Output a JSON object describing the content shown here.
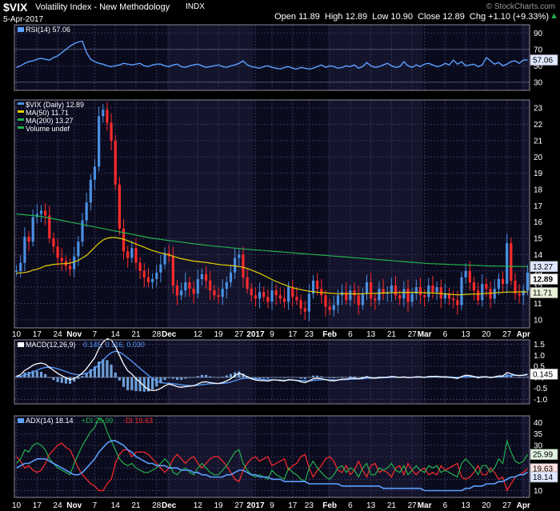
{
  "header": {
    "symbol": "$VIX",
    "title": "Volatility Index - New Methodology",
    "exchange": "INDX",
    "date": "5-Apr-2017",
    "watermark": "© StockCharts.com",
    "ohlc": "Open 11.89  High 12.89  Low 10.90  Close 12.89  Chg +1.10 (+9.33%)",
    "change_arrow": "▲"
  },
  "colors": {
    "background": "#000000",
    "panel": "#0b0b1e",
    "grid": "#35355a",
    "up": "#4a90e2",
    "down": "#ff2b2b",
    "ma50": "#e6d200",
    "ma200": "#22b14c",
    "rsi": "#5aa0ff",
    "macd_fast": "#ffffff",
    "macd_signal": "#5aa0ff",
    "macd_hist": "#6f9fd8",
    "adx": "#5aa0ff",
    "plus_di": "#22b14c",
    "minus_di": "#ff2b2b"
  },
  "x_axis": {
    "labels": [
      "10",
      "17",
      "24",
      "Nov",
      "7",
      "14",
      "21",
      "28",
      "Dec",
      "12",
      "19",
      "27",
      "2017",
      "9",
      "17",
      "23",
      "Feb",
      "6",
      "13",
      "21",
      "27",
      "Mar",
      "6",
      "13",
      "20",
      "27",
      "Apr"
    ],
    "label_index": [
      0,
      5,
      10,
      14,
      19,
      24,
      29,
      34,
      37,
      44,
      49,
      54,
      58,
      62,
      67,
      71,
      76,
      81,
      86,
      91,
      96,
      99,
      104,
      109,
      114,
      119,
      123
    ],
    "month_index": [
      14,
      37,
      58,
      76,
      99,
      123
    ]
  },
  "chart_data": [
    {
      "type": "line",
      "name": "rsi",
      "legend": "RSI(14) 57.06",
      "last_label": "57.06",
      "yticks": [
        "90",
        "70",
        "50",
        "30"
      ],
      "ylim": [
        20,
        100
      ],
      "ref_levels": [
        70,
        30
      ],
      "values": [
        48,
        50,
        53,
        55,
        56,
        58,
        59,
        58,
        57,
        60,
        62,
        66,
        70,
        74,
        77,
        79,
        80,
        66,
        58,
        55,
        53,
        52,
        50,
        49,
        50,
        51,
        53,
        52,
        51,
        52,
        53,
        50,
        49,
        51,
        52,
        52,
        50,
        49,
        51,
        52,
        49,
        48,
        50,
        51,
        52,
        50,
        48,
        49,
        50,
        51,
        49,
        48,
        50,
        51,
        53,
        56,
        51,
        49,
        48,
        47,
        49,
        50,
        48,
        47,
        46,
        48,
        49,
        47,
        46,
        48,
        47,
        46,
        47,
        49,
        51,
        48,
        50,
        49,
        47,
        48,
        50,
        49,
        51,
        47,
        49,
        54,
        50,
        48,
        49,
        51,
        53,
        50,
        48,
        49,
        55,
        50,
        48,
        51,
        49,
        52,
        53,
        51,
        49,
        50,
        53,
        51,
        57,
        52,
        55,
        50,
        51,
        52,
        49,
        51,
        60,
        56,
        52,
        54,
        50,
        52,
        55,
        56,
        53,
        57,
        57.06
      ]
    },
    {
      "type": "candlestick",
      "name": "price",
      "legend": [
        "$VIX (Daily) 12.89",
        "MA(50) 11.71",
        "MA(200) 13.27",
        "Volume undef"
      ],
      "yticks": [
        "23",
        "22",
        "21",
        "20",
        "19",
        "18",
        "17",
        "16",
        "15",
        "14",
        "13",
        "12",
        "11",
        "10"
      ],
      "ylim": [
        9.5,
        23.5
      ],
      "last_close_label": "12.89",
      "ma50_label": "11.71",
      "ma200_label": "13.27",
      "close": [
        13.0,
        13.5,
        15.1,
        14.8,
        16.3,
        16.5,
        16.7,
        16.4,
        15.0,
        14.5,
        13.8,
        13.6,
        13.3,
        13.1,
        13.9,
        14.8,
        16.1,
        17.2,
        18.6,
        19.4,
        22.5,
        22.9,
        22.1,
        21.0,
        18.3,
        15.6,
        14.2,
        13.8,
        14.4,
        13.5,
        13.0,
        12.6,
        12.3,
        12.5,
        12.9,
        13.4,
        14.1,
        13.9,
        12.1,
        11.5,
        11.8,
        12.3,
        11.9,
        11.6,
        12.5,
        12.8,
        12.4,
        11.8,
        11.5,
        11.4,
        11.9,
        12.3,
        12.9,
        13.8,
        14.0,
        12.6,
        11.9,
        11.5,
        11.3,
        11.7,
        11.4,
        11.1,
        11.8,
        11.5,
        11.3,
        11.1,
        12.0,
        11.4,
        11.2,
        10.7,
        10.5,
        11.6,
        12.4,
        11.9,
        11.5,
        10.8,
        10.6,
        10.9,
        11.5,
        11.7,
        11.2,
        11.8,
        11.5,
        10.9,
        11.6,
        12.3,
        11.3,
        11.2,
        11.9,
        11.6,
        11.7,
        12.1,
        11.5,
        11.3,
        11.9,
        11.1,
        11.6,
        12.0,
        11.5,
        11.4,
        12.1,
        11.7,
        12.0,
        11.3,
        11.6,
        11.3,
        11.2,
        10.9,
        12.6,
        13.0,
        12.3,
        11.8,
        11.2,
        12.2,
        11.9,
        11.3,
        11.9,
        12.5,
        12.2,
        14.7,
        12.4,
        11.6,
        11.5,
        11.8,
        12.89
      ],
      "ma50": [
        12.85,
        12.88,
        12.9,
        12.95,
        13.05,
        13.1,
        13.2,
        13.3,
        13.35,
        13.4,
        13.42,
        13.44,
        13.45,
        13.48,
        13.55,
        13.65,
        13.8,
        13.95,
        14.2,
        14.45,
        14.7,
        14.9,
        15.0,
        15.05,
        15.05,
        15.0,
        14.95,
        14.85,
        14.75,
        14.65,
        14.55,
        14.45,
        14.35,
        14.25,
        14.18,
        14.1,
        14.05,
        13.98,
        13.9,
        13.82,
        13.75,
        13.7,
        13.65,
        13.6,
        13.57,
        13.55,
        13.52,
        13.48,
        13.44,
        13.4,
        13.37,
        13.35,
        13.33,
        13.3,
        13.27,
        13.22,
        13.15,
        13.05,
        12.95,
        12.85,
        12.72,
        12.6,
        12.47,
        12.35,
        12.25,
        12.15,
        12.05,
        11.97,
        11.9,
        11.85,
        11.8,
        11.75,
        11.72,
        11.69,
        11.67,
        11.65,
        11.63,
        11.62,
        11.6,
        11.6,
        11.6,
        11.6,
        11.59,
        11.59,
        11.6,
        11.61,
        11.62,
        11.62,
        11.63,
        11.64,
        11.65,
        11.66,
        11.66,
        11.67,
        11.68,
        11.68,
        11.68,
        11.68,
        11.67,
        11.66,
        11.65,
        11.64,
        11.63,
        11.61,
        11.59,
        11.57,
        11.55,
        11.53,
        11.54,
        11.56,
        11.57,
        11.58,
        11.58,
        11.6,
        11.62,
        11.63,
        11.65,
        11.67,
        11.68,
        11.7,
        11.7,
        11.7,
        11.71,
        11.71,
        11.71
      ],
      "ma200": [
        16.5,
        16.47,
        16.45,
        16.42,
        16.4,
        16.37,
        16.35,
        16.3,
        16.25,
        16.2,
        16.15,
        16.1,
        16.05,
        16.0,
        15.95,
        15.9,
        15.85,
        15.8,
        15.75,
        15.7,
        15.65,
        15.6,
        15.55,
        15.5,
        15.45,
        15.4,
        15.35,
        15.3,
        15.25,
        15.2,
        15.15,
        15.1,
        15.05,
        15.0,
        14.97,
        14.94,
        14.9,
        14.87,
        14.84,
        14.8,
        14.77,
        14.74,
        14.7,
        14.67,
        14.64,
        14.61,
        14.58,
        14.55,
        14.52,
        14.5,
        14.47,
        14.45,
        14.42,
        14.4,
        14.38,
        14.35,
        14.33,
        14.31,
        14.29,
        14.27,
        14.25,
        14.23,
        14.21,
        14.19,
        14.17,
        14.15,
        14.13,
        14.11,
        14.09,
        14.07,
        14.05,
        14.03,
        14.01,
        13.99,
        13.97,
        13.95,
        13.93,
        13.91,
        13.89,
        13.87,
        13.85,
        13.83,
        13.81,
        13.79,
        13.77,
        13.75,
        13.73,
        13.71,
        13.69,
        13.67,
        13.65,
        13.63,
        13.61,
        13.59,
        13.57,
        13.55,
        13.53,
        13.51,
        13.49,
        13.47,
        13.45,
        13.44,
        13.43,
        13.42,
        13.41,
        13.4,
        13.39,
        13.38,
        13.37,
        13.36,
        13.35,
        13.34,
        13.33,
        13.32,
        13.31,
        13.3,
        13.3,
        13.29,
        13.29,
        13.28,
        13.28,
        13.28,
        13.27,
        13.27,
        13.27
      ]
    },
    {
      "type": "line",
      "name": "macd",
      "legend_main": "MACD(12,26,9)",
      "legend_values": "0.145, 0.116, 0.030",
      "last_label": "0.145",
      "yticks": [
        "1.5",
        "1.0",
        "0.5",
        "0.0",
        "-0.5",
        "-1.0"
      ],
      "ylim": [
        -1.2,
        1.7
      ],
      "zero_line": 0,
      "macd": [
        0.05,
        0.12,
        0.32,
        0.42,
        0.55,
        0.62,
        0.65,
        0.6,
        0.45,
        0.32,
        0.18,
        0.08,
        -0.02,
        -0.1,
        -0.05,
        0.05,
        0.2,
        0.4,
        0.65,
        0.9,
        1.3,
        1.6,
        1.75,
        1.7,
        1.4,
        1.0,
        0.6,
        0.3,
        0.15,
        -0.05,
        -0.22,
        -0.4,
        -0.55,
        -0.6,
        -0.58,
        -0.5,
        -0.38,
        -0.3,
        -0.35,
        -0.42,
        -0.45,
        -0.42,
        -0.4,
        -0.38,
        -0.3,
        -0.22,
        -0.2,
        -0.24,
        -0.26,
        -0.28,
        -0.24,
        -0.16,
        -0.06,
        0.08,
        0.18,
        0.12,
        0.02,
        -0.06,
        -0.12,
        -0.14,
        -0.15,
        -0.17,
        -0.12,
        -0.12,
        -0.14,
        -0.16,
        -0.1,
        -0.12,
        -0.14,
        -0.2,
        -0.24,
        -0.16,
        -0.06,
        -0.04,
        -0.06,
        -0.1,
        -0.14,
        -0.16,
        -0.12,
        -0.08,
        -0.08,
        -0.04,
        -0.04,
        -0.06,
        -0.03,
        0.02,
        -0.02,
        -0.04,
        0.0,
        0.0,
        0.01,
        0.04,
        0.02,
        0.0,
        0.02,
        -0.01,
        0.0,
        0.03,
        0.02,
        0.0,
        0.04,
        0.04,
        0.05,
        0.02,
        0.02,
        0.0,
        -0.02,
        -0.05,
        0.04,
        0.1,
        0.08,
        0.04,
        -0.02,
        0.02,
        0.03,
        -0.01,
        0.02,
        0.06,
        0.06,
        0.22,
        0.16,
        0.1,
        0.08,
        0.1,
        0.145
      ],
      "signal": [
        0.02,
        0.05,
        0.1,
        0.17,
        0.25,
        0.33,
        0.4,
        0.45,
        0.46,
        0.44,
        0.39,
        0.33,
        0.26,
        0.19,
        0.14,
        0.12,
        0.14,
        0.19,
        0.28,
        0.4,
        0.58,
        0.78,
        0.97,
        1.12,
        1.18,
        1.14,
        1.03,
        0.88,
        0.73,
        0.57,
        0.41,
        0.25,
        0.09,
        -0.05,
        -0.16,
        -0.23,
        -0.26,
        -0.27,
        -0.29,
        -0.31,
        -0.34,
        -0.36,
        -0.37,
        -0.37,
        -0.36,
        -0.33,
        -0.31,
        -0.29,
        -0.28,
        -0.28,
        -0.27,
        -0.25,
        -0.21,
        -0.15,
        -0.09,
        -0.05,
        -0.04,
        -0.04,
        -0.06,
        -0.08,
        -0.1,
        -0.11,
        -0.11,
        -0.12,
        -0.12,
        -0.13,
        -0.12,
        -0.12,
        -0.13,
        -0.14,
        -0.16,
        -0.16,
        -0.14,
        -0.12,
        -0.11,
        -0.11,
        -0.11,
        -0.12,
        -0.12,
        -0.11,
        -0.1,
        -0.09,
        -0.08,
        -0.07,
        -0.06,
        -0.04,
        -0.04,
        -0.04,
        -0.03,
        -0.02,
        -0.01,
        0.0,
        0.0,
        0.0,
        0.0,
        0.0,
        0.0,
        0.0,
        0.01,
        0.01,
        0.01,
        0.02,
        0.03,
        0.03,
        0.03,
        0.02,
        0.01,
        0.0,
        0.0,
        0.02,
        0.03,
        0.03,
        0.02,
        0.02,
        0.02,
        0.01,
        0.01,
        0.02,
        0.03,
        0.07,
        0.09,
        0.09,
        0.09,
        0.09,
        0.116
      ]
    },
    {
      "type": "line",
      "name": "adx",
      "legend_adx": "ADX(14) 18.14",
      "legend_pdi": "+DI 25.99",
      "legend_mdi": "-DI 19.63",
      "labels_right": [
        "25.99",
        "19.63",
        "18.14"
      ],
      "yticks": [
        "40",
        "35",
        "30",
        "25",
        "20",
        "15",
        "10"
      ],
      "ylim": [
        7,
        43
      ],
      "adx": [
        20,
        21,
        22,
        22,
        23,
        24,
        24,
        24,
        23,
        22,
        21,
        20,
        19,
        18,
        17,
        17,
        18,
        20,
        22,
        24,
        27,
        29,
        31,
        32,
        32,
        31,
        30,
        28,
        27,
        25,
        24,
        23,
        22,
        22,
        21,
        21,
        21,
        20,
        20,
        20,
        19,
        19,
        19,
        18,
        18,
        17,
        17,
        16,
        16,
        16,
        16,
        17,
        17,
        18,
        19,
        19,
        18,
        17,
        17,
        16,
        16,
        16,
        15,
        15,
        15,
        14,
        14,
        14,
        14,
        14,
        14,
        13,
        13,
        13,
        13,
        13,
        13,
        13,
        13,
        12,
        12,
        12,
        12,
        12,
        12,
        12,
        12,
        12,
        12,
        11,
        11,
        11,
        11,
        11,
        11,
        11,
        11,
        11,
        11,
        10,
        10,
        10,
        10,
        10,
        10,
        10,
        10,
        10,
        10,
        11,
        11,
        12,
        12,
        12,
        13,
        13,
        13,
        14,
        14,
        15,
        16,
        16,
        17,
        17,
        18.14
      ],
      "plus_di": [
        22,
        24,
        28,
        27,
        30,
        31,
        30,
        28,
        24,
        22,
        20,
        19,
        18,
        17,
        22,
        26,
        30,
        33,
        36,
        38,
        42,
        41,
        36,
        32,
        28,
        24,
        22,
        21,
        22,
        20,
        19,
        18,
        18,
        19,
        20,
        22,
        24,
        22,
        18,
        17,
        19,
        20,
        18,
        17,
        20,
        22,
        20,
        18,
        17,
        17,
        19,
        21,
        24,
        27,
        28,
        22,
        19,
        17,
        16,
        17,
        16,
        15,
        19,
        17,
        16,
        15,
        20,
        18,
        17,
        15,
        14,
        20,
        23,
        20,
        18,
        16,
        15,
        17,
        20,
        21,
        18,
        20,
        19,
        16,
        20,
        22,
        17,
        17,
        20,
        19,
        20,
        22,
        19,
        18,
        21,
        17,
        19,
        21,
        19,
        18,
        21,
        20,
        21,
        18,
        19,
        18,
        17,
        16,
        22,
        24,
        22,
        20,
        17,
        21,
        21,
        18,
        20,
        24,
        22,
        32,
        27,
        23,
        22,
        23,
        25.99
      ],
      "minus_di": [
        25,
        23,
        20,
        21,
        19,
        18,
        19,
        22,
        26,
        28,
        30,
        31,
        29,
        28,
        24,
        20,
        17,
        15,
        13,
        12,
        10,
        10,
        13,
        15,
        22,
        26,
        28,
        28,
        25,
        27,
        27,
        27,
        26,
        24,
        22,
        20,
        18,
        20,
        24,
        26,
        24,
        22,
        24,
        25,
        22,
        20,
        22,
        24,
        25,
        25,
        23,
        21,
        18,
        15,
        14,
        19,
        22,
        24,
        25,
        23,
        24,
        25,
        21,
        22,
        23,
        24,
        19,
        21,
        22,
        25,
        26,
        20,
        16,
        19,
        21,
        24,
        25,
        23,
        19,
        18,
        21,
        17,
        19,
        23,
        19,
        16,
        21,
        22,
        18,
        19,
        18,
        16,
        20,
        21,
        17,
        22,
        19,
        17,
        19,
        20,
        17,
        18,
        17,
        21,
        19,
        20,
        21,
        22,
        16,
        15,
        16,
        18,
        21,
        17,
        17,
        20,
        18,
        15,
        16,
        10,
        13,
        16,
        17,
        18,
        19.63
      ]
    }
  ]
}
